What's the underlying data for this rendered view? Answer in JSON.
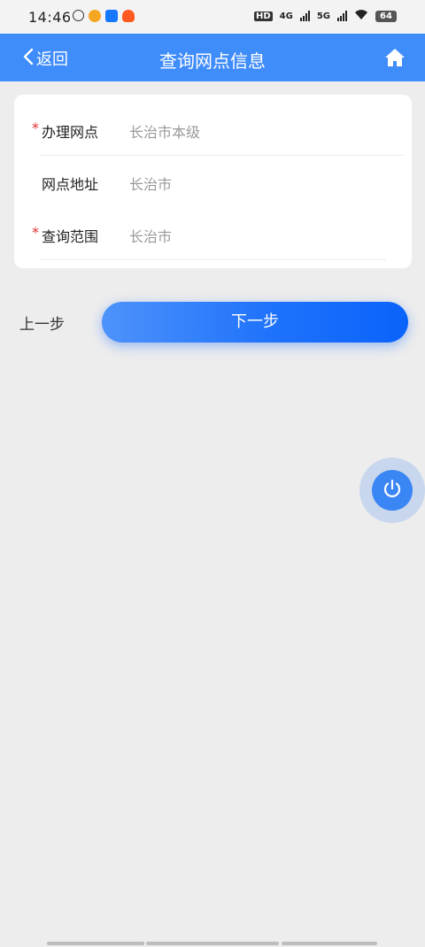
{
  "status_bar": {
    "time": "14:46",
    "hd_label": "HD",
    "network_4g": "4G",
    "network_5g": "5G",
    "battery": "64"
  },
  "nav": {
    "back_label": "返回",
    "title": "查询网点信息",
    "home_icon": "home-icon",
    "bar_color": "#3f8cfb"
  },
  "form": {
    "fields": [
      {
        "label": "办理网点",
        "value": "长治市本级",
        "required": true
      },
      {
        "label": "网点地址",
        "value": "长治市",
        "required": false
      },
      {
        "label": "查询范围",
        "value": "长治市",
        "required": true
      }
    ],
    "required_mark": "*"
  },
  "actions": {
    "prev_label": "上一步",
    "next_label": "下一步"
  },
  "fab": {
    "icon": "power-icon"
  }
}
